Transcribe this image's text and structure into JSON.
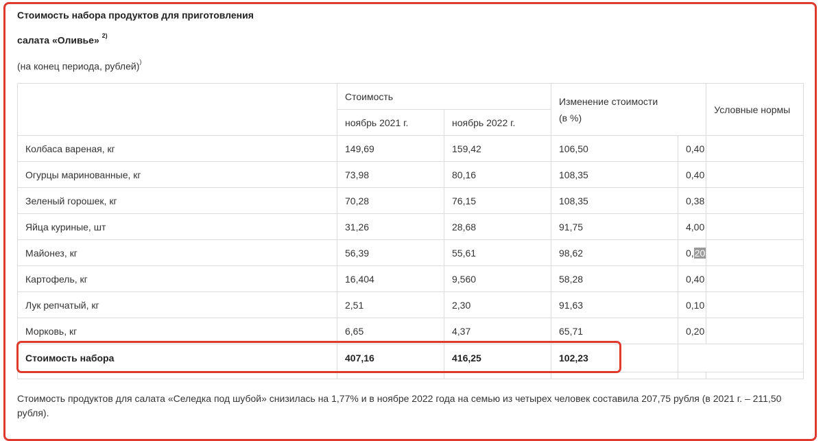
{
  "title": {
    "line1": "Стоимость набора продуктов для приготовления",
    "line2": "салата «Оливье»",
    "line2_sup": "2)",
    "subtitle": "(на конец периода, рублей)",
    "subtitle_sup": ")"
  },
  "headers": {
    "cost": "Стоимость",
    "nov2021": "ноябрь 2021 г.",
    "nov2022": "ноябрь 2022 г.",
    "change": "Изменение  стоимости",
    "change_unit": "(в %)",
    "norms": "Условные нормы"
  },
  "rows": [
    {
      "name": "Колбаса вареная, кг",
      "v2021": "149,69",
      "v2022": "159,42",
      "change": "106,50",
      "norm": "0,40"
    },
    {
      "name": "Огурцы маринованные, кг",
      "v2021": "73,98",
      "v2022": "80,16",
      "change": "108,35",
      "norm": "0,40"
    },
    {
      "name": "Зеленый горошек, кг",
      "v2021": "70,28",
      "v2022": "76,15",
      "change": "108,35",
      "norm": "0,38"
    },
    {
      "name": "Яйца куриные, шт",
      "v2021": "31,26",
      "v2022": "28,68",
      "change": "91,75",
      "norm": "4,00"
    },
    {
      "name": "Майонез, кг",
      "v2021": "56,39",
      "v2022": "55,61",
      "change": "98,62",
      "norm_prefix": "0,",
      "norm_highlight": "20"
    },
    {
      "name": "Картофель, кг",
      "v2021": "16,404",
      "v2022": "9,560",
      "change": "58,28",
      "norm": "0,40"
    },
    {
      "name": "Лук репчатый, кг",
      "v2021": "2,51",
      "v2022": "2,30",
      "change": "91,63",
      "norm": "0,10"
    },
    {
      "name": "Морковь, кг",
      "v2021": "6,65",
      "v2022": "4,37",
      "change": "65,71",
      "norm": "0,20"
    }
  ],
  "total": {
    "name": "Стоимость набора",
    "v2021": "407,16",
    "v2022": "416,25",
    "change": "102,23"
  },
  "footer": "Стоимость  продуктов для салата «Селедка под шубой» снизилась на 1,77% и в ноябре 2022 года на семью из четырех человек составила 207,75 рубля (в 2021 г. – 211,50 рубля).",
  "colors": {
    "highlight_border": "#e03a2f",
    "grid": "#dcdcdc",
    "selection": "#9a9a9a"
  }
}
